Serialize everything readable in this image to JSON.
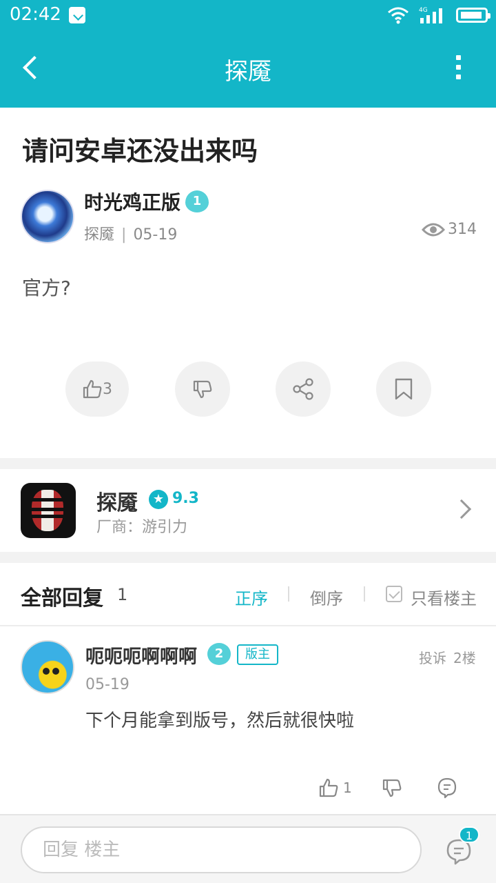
{
  "status": {
    "time": "02:42",
    "network": "4G"
  },
  "header": {
    "title": "探魇"
  },
  "post": {
    "title": "请问安卓还没出来吗",
    "author": "时光鸡正版",
    "level": "1",
    "board": "探魇",
    "separator": "|",
    "date": "05-19",
    "views": "314",
    "content": "官方?",
    "likes": "3"
  },
  "game": {
    "name": "探魇",
    "score": "9.3",
    "vendor": "厂商：游引力"
  },
  "replies": {
    "title": "全部回复",
    "count": "1",
    "sort_asc": "正序",
    "sort_desc": "倒序",
    "only_op": "只看楼主",
    "items": [
      {
        "name": "呃呃呃啊啊啊",
        "level": "2",
        "badge": "版主",
        "report": "投诉",
        "floor": "2楼",
        "date": "05-19",
        "text": "下个月能拿到版号，然后就很快啦",
        "likes": "1"
      }
    ]
  },
  "bottom": {
    "placeholder": "回复 楼主",
    "comment_count": "1"
  },
  "colors": {
    "accent": "#13b6c8",
    "level_badge": "#54d0d8"
  }
}
